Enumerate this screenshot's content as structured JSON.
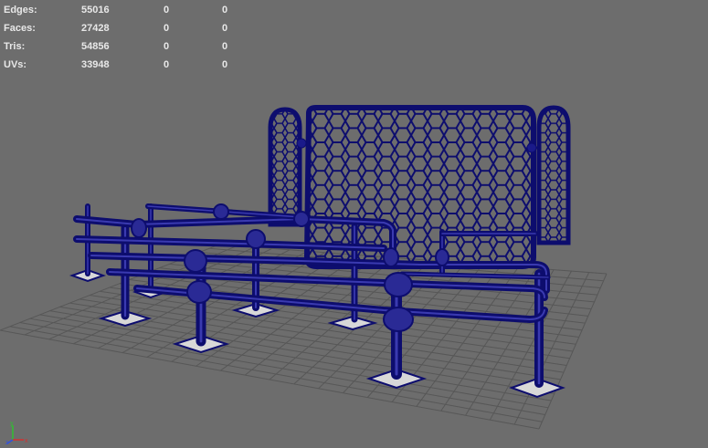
{
  "stats": {
    "rows": [
      {
        "label": "Edges:",
        "v1": "55016",
        "v2": "0",
        "v3": "0"
      },
      {
        "label": "Faces:",
        "v1": "27428",
        "v2": "0",
        "v3": "0"
      },
      {
        "label": "Tris:",
        "v1": "54856",
        "v2": "0",
        "v3": "0"
      },
      {
        "label": "UVs:",
        "v1": "33948",
        "v2": "0",
        "v3": "0"
      }
    ]
  },
  "axis": {
    "x": "x",
    "y": "y",
    "z": "z"
  },
  "colors": {
    "background": "#6d6d6d",
    "grid": "#555555",
    "wireframe": "#0d0d6e",
    "wire_fill": "#1a1a8a",
    "hud_text": "#e8e8e8",
    "axis_x": "#d43030",
    "axis_y": "#30c030",
    "axis_z": "#3050e0"
  }
}
